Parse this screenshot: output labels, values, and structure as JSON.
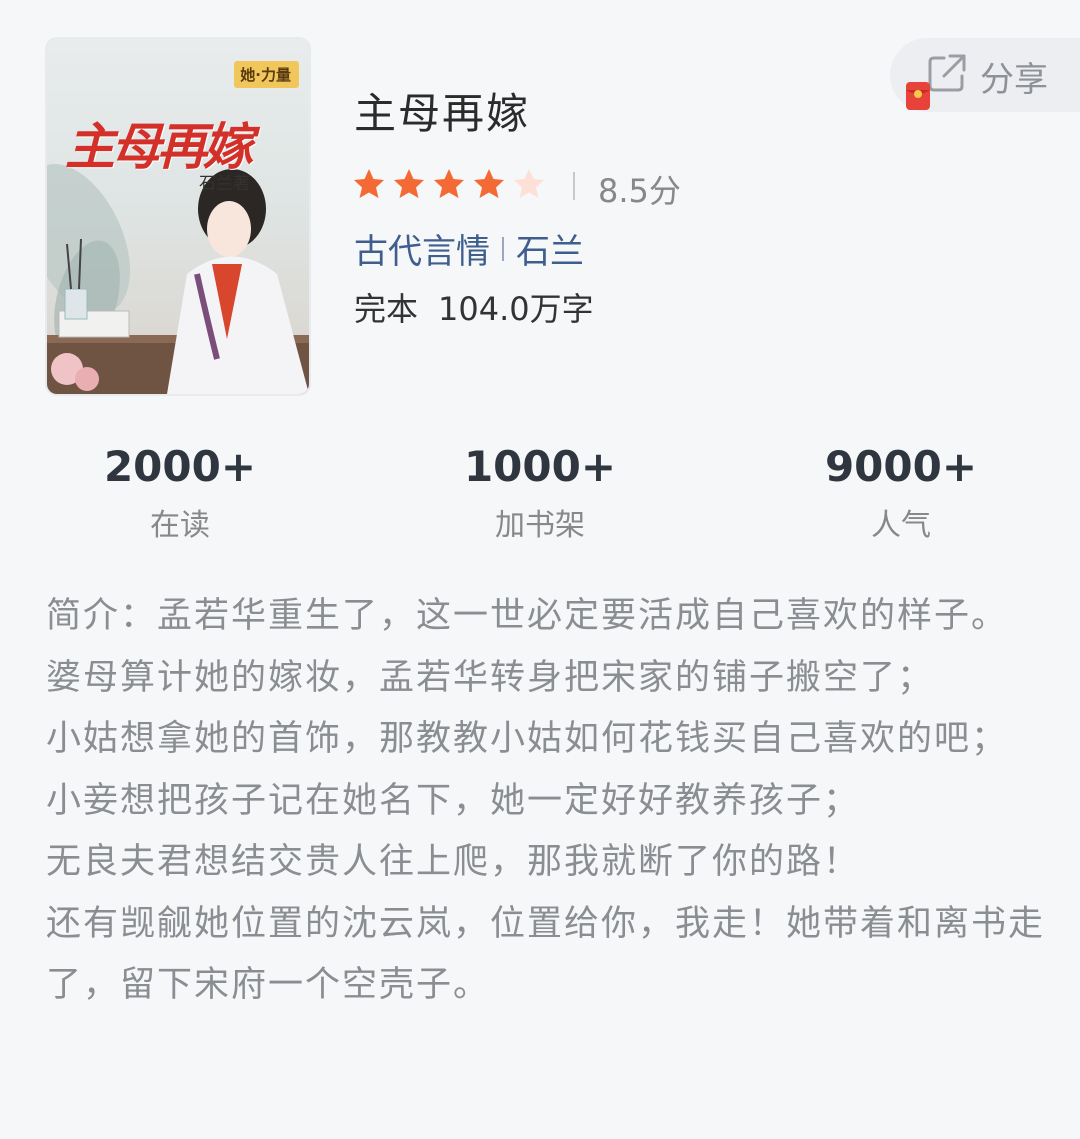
{
  "cover": {
    "badge": "她·力量",
    "title": "主母再嫁",
    "author": "石兰著"
  },
  "book": {
    "title": "主母再嫁",
    "rating_stars": 4,
    "rating_max": 5,
    "score": "8.5分",
    "category": "古代言情",
    "author": "石兰",
    "status": "完本",
    "word_count": "104.0万字"
  },
  "share": {
    "label": "分享"
  },
  "stats": [
    {
      "value": "2000+",
      "label": "在读"
    },
    {
      "value": "1000+",
      "label": "加书架"
    },
    {
      "value": "9000+",
      "label": "人气"
    }
  ],
  "intro": {
    "lines": [
      "简介：孟若华重生了，这一世必定要活成自己喜欢的样子。",
      "婆母算计她的嫁妆，孟若华转身把宋家的铺子搬空了；",
      "小姑想拿她的首饰，那教教小姑如何花钱买自己喜欢的吧；",
      "小妾想把孩子记在她名下，她一定好好教养孩子；",
      "无良夫君想结交贵人往上爬，那我就断了你的路！",
      "还有觊觎她位置的沈云岚，位置给你，我走！她带着和离书走了，留下宋府一个空壳子。"
    ]
  },
  "colors": {
    "star_filled": "#f46a35",
    "star_empty": "#fde1d6",
    "link": "#3e5e8d",
    "text_muted": "#8a8d92",
    "background": "#f6f7f9"
  }
}
